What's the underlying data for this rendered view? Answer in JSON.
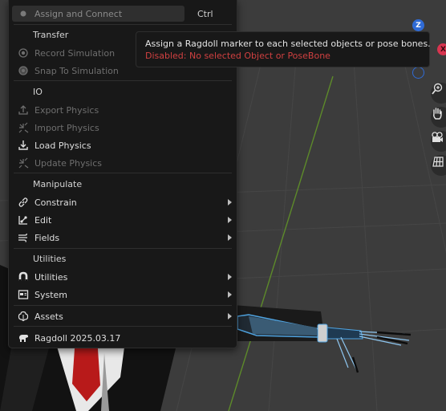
{
  "menu": {
    "top_item": {
      "label": "Assign and Connect",
      "shortcut": "Ctrl"
    },
    "sections": {
      "transfer": "Transfer",
      "io": "IO",
      "manipulate": "Manipulate",
      "utilities": "Utilities"
    },
    "items": {
      "record_simulation": "Record Simulation",
      "snap_to_simulation": "Snap To Simulation",
      "export_physics": "Export Physics",
      "import_physics": "Import Physics",
      "load_physics": "Load Physics",
      "update_physics": "Update Physics",
      "constrain": "Constrain",
      "edit": "Edit",
      "fields": "Fields",
      "utilities": "Utilities",
      "system": "System",
      "assets": "Assets",
      "version": "Ragdoll 2025.03.17"
    }
  },
  "tooltip": {
    "description": "Assign a Ragdoll marker to each selected objects or pose bones.",
    "disabled_reason": "Disabled: No selected Object or PoseBone"
  },
  "gizmo": {
    "z_label": "Z",
    "x_label": "X"
  },
  "colors": {
    "menu_bg": "#181818",
    "viewport_bg": "#3c3c3c",
    "disabled_text": "#6e6e6e",
    "error_text": "#d04040",
    "selection_blue": "#4fa3e0",
    "axis_z": "#2f6bd6",
    "axis_x": "#d8344f"
  }
}
